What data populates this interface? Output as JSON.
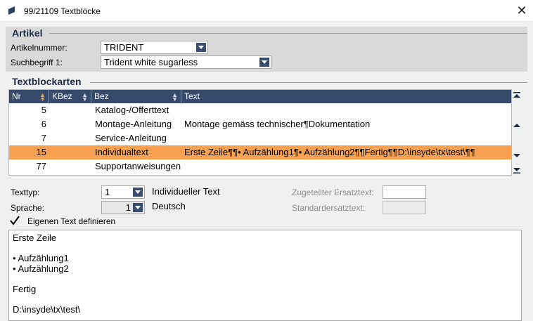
{
  "window": {
    "title": "99/21109 Textblöcke",
    "icon": "app-logo-icon",
    "close_glyph": "✕"
  },
  "artikel": {
    "title": "Artikel",
    "artikelnummer_label": "Artikelnummer:",
    "artikelnummer_value": "TRIDENT",
    "suchbegriff_label": "Suchbegriff 1:",
    "suchbegriff_value": "Trident white sugarless"
  },
  "textblockarten": {
    "title": "Textblockarten",
    "columns": [
      "Nr",
      "KBez",
      "Bez",
      "Text"
    ],
    "rows": [
      {
        "nr": "5",
        "kbez": "",
        "bez": "Katalog-/Offerttext",
        "text": ""
      },
      {
        "nr": "6",
        "kbez": "",
        "bez": "Montage-Anleitung",
        "text": "Montage gemäss technischer¶Dokumentation"
      },
      {
        "nr": "7",
        "kbez": "",
        "bez": "Service-Anleitung",
        "text": ""
      },
      {
        "nr": "15",
        "kbez": "",
        "bez": "Individualtext",
        "text": "Erste Zeile¶¶• Aufzählung1¶• Aufzählung2¶¶Fertig¶¶D:\\insyde\\tx\\test\\¶¶"
      },
      {
        "nr": "77",
        "kbez": "",
        "bez": "Supportanweisungen",
        "text": ""
      }
    ],
    "selected_index": 3
  },
  "details": {
    "texttyp_label": "Texttyp:",
    "texttyp_value": "1",
    "texttyp_desc": "Individueller Text",
    "sprache_label": "Sprache:",
    "sprache_value": "1",
    "sprache_desc": "Deutsch",
    "zugeteilter_label": "Zugeteilter Ersatztext:",
    "standard_label": "Standardersatztext:",
    "eigenen_label": "Eigenen Text definieren",
    "eigenen_checked": true
  },
  "editor": {
    "content": "Erste Zeile\n\n• Aufzählung1\n• Aufzählung2\n\nFertig\n\nD:\\insyde\\tx\\test\\"
  },
  "colors": {
    "header_bg": "#364a6b",
    "selected_row": "#f7a04f",
    "section_title": "#1f2a44"
  }
}
